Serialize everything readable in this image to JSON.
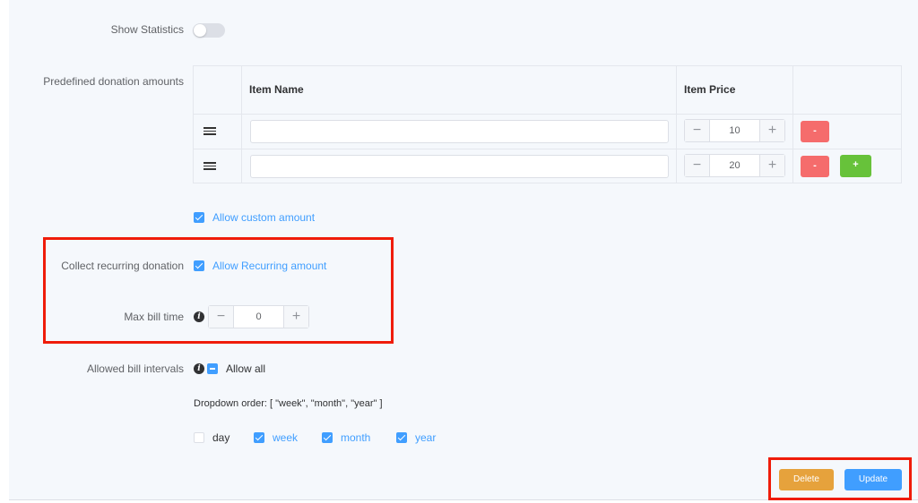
{
  "show_statistics": {
    "label": "Show Statistics",
    "enabled": false
  },
  "donation_amounts": {
    "label": "Predefined donation amounts",
    "headers": {
      "item_name": "Item Name",
      "item_price": "Item Price"
    },
    "rows": [
      {
        "name": "",
        "price": "10",
        "minus": "−",
        "plus": "+",
        "remove": "-"
      },
      {
        "name": "",
        "price": "20",
        "minus": "−",
        "plus": "+",
        "remove": "-",
        "add": "+"
      }
    ]
  },
  "custom_amount": {
    "label": "Allow custom amount",
    "checked": true
  },
  "recurring": {
    "field_label": "Collect recurring donation",
    "checkbox_label": "Allow Recurring amount",
    "checked": true
  },
  "max_bill_time": {
    "label": "Max bill time",
    "value": "0",
    "minus": "−",
    "plus": "+"
  },
  "bill_intervals": {
    "label": "Allowed bill intervals",
    "allow_all": "Allow all",
    "dropdown_order": "Dropdown order: [ \"week\", \"month\", \"year\" ]",
    "options": [
      {
        "label": "day",
        "checked": false
      },
      {
        "label": "week",
        "checked": true
      },
      {
        "label": "month",
        "checked": true
      },
      {
        "label": "year",
        "checked": true
      }
    ]
  },
  "info_glyph": "i",
  "actions": {
    "delete": "Delete",
    "update": "Update"
  },
  "colors": {
    "primary": "#409eff",
    "danger": "#f56c6c",
    "success": "#67c23a",
    "warning": "#e6a23c",
    "highlight": "#ef1c0a"
  }
}
